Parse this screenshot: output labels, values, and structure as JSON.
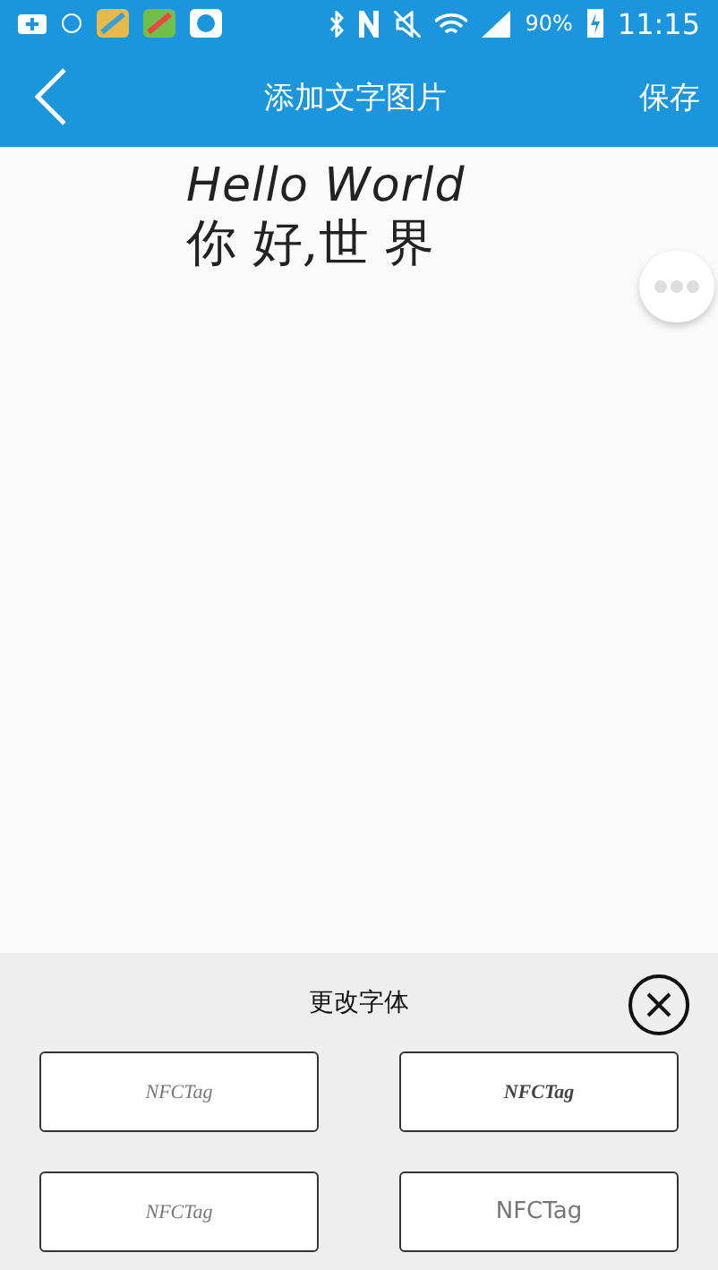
{
  "status_bar": {
    "battery": "90%",
    "time": "11:15"
  },
  "nav": {
    "title": "添加文字图片",
    "action": "保存"
  },
  "canvas": {
    "lines": [
      {
        "kind": "latin",
        "text": "Hello World"
      },
      {
        "kind": "hanzi",
        "text": "你 好,世 界"
      }
    ]
  },
  "font_panel": {
    "title": "更改字体",
    "fonts": [
      {
        "kind": "thin-script",
        "label": "NFCTag"
      },
      {
        "kind": "bold-script",
        "label": "NFCTag"
      },
      {
        "kind": "thin-script",
        "label": "NFCTag"
      },
      {
        "kind": "sans",
        "label": "NFCTag"
      }
    ]
  }
}
